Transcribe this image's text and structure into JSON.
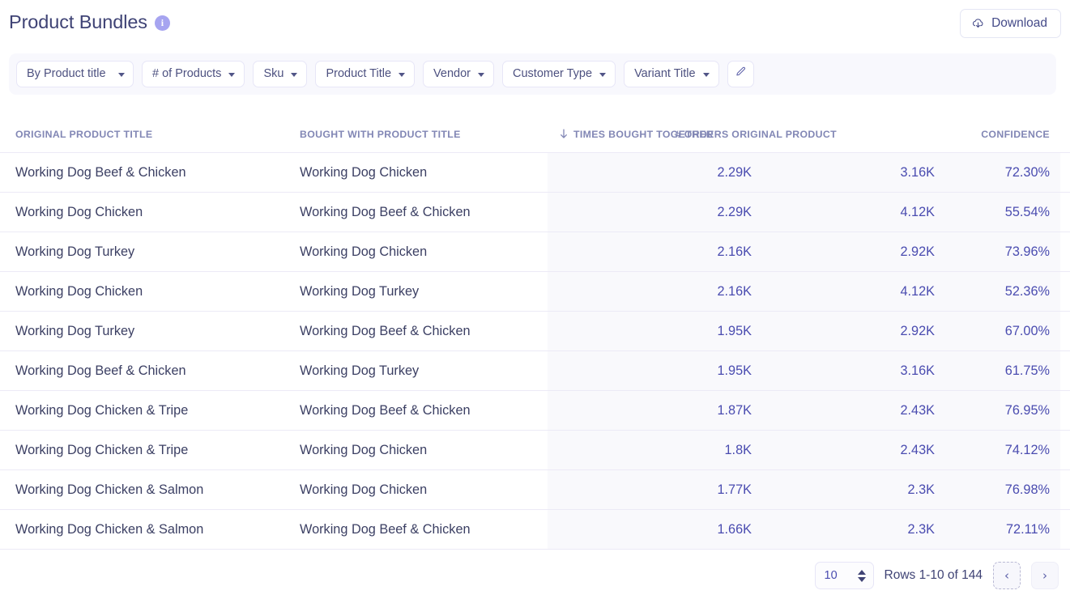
{
  "header": {
    "title": "Product Bundles",
    "info_icon": "info-icon",
    "info_glyph": "i",
    "download_label": "Download",
    "download_icon": "cloud-download-icon"
  },
  "filters": {
    "chips": [
      {
        "label": "By Product title",
        "icon": "chevron-down-icon"
      },
      {
        "label": "# of Products",
        "icon": "chevron-down-icon"
      },
      {
        "label": "Sku",
        "icon": "chevron-down-icon"
      },
      {
        "label": "Product Title",
        "icon": "chevron-down-icon"
      },
      {
        "label": "Vendor",
        "icon": "chevron-down-icon"
      },
      {
        "label": "Customer Type",
        "icon": "chevron-down-icon"
      },
      {
        "label": "Variant Title",
        "icon": "chevron-down-icon"
      }
    ],
    "edit_icon": "pencil-icon"
  },
  "table": {
    "columns": [
      {
        "key": "original",
        "label": "ORIGINAL PRODUCT TITLE",
        "align": "left"
      },
      {
        "key": "bought_with",
        "label": "BOUGHT WITH PRODUCT TITLE",
        "align": "left"
      },
      {
        "key": "times",
        "label": "TIMES BOUGHT TOGETHER",
        "align": "right",
        "sorted": "desc",
        "sort_icon": "arrow-down-icon"
      },
      {
        "key": "orders",
        "label": "# ORDERS ORIGINAL PRODUCT",
        "align": "right"
      },
      {
        "key": "confidence",
        "label": "CONFIDENCE",
        "align": "right"
      }
    ],
    "rows": [
      {
        "original": "Working Dog Beef & Chicken",
        "bought_with": "Working Dog Chicken",
        "times": "2.29K",
        "orders": "3.16K",
        "confidence": "72.30%"
      },
      {
        "original": "Working Dog Chicken",
        "bought_with": "Working Dog Beef & Chicken",
        "times": "2.29K",
        "orders": "4.12K",
        "confidence": "55.54%"
      },
      {
        "original": "Working Dog Turkey",
        "bought_with": "Working Dog Chicken",
        "times": "2.16K",
        "orders": "2.92K",
        "confidence": "73.96%"
      },
      {
        "original": "Working Dog Chicken",
        "bought_with": "Working Dog Turkey",
        "times": "2.16K",
        "orders": "4.12K",
        "confidence": "52.36%"
      },
      {
        "original": "Working Dog Turkey",
        "bought_with": "Working Dog Beef & Chicken",
        "times": "1.95K",
        "orders": "2.92K",
        "confidence": "67.00%"
      },
      {
        "original": "Working Dog Beef & Chicken",
        "bought_with": "Working Dog Turkey",
        "times": "1.95K",
        "orders": "3.16K",
        "confidence": "61.75%"
      },
      {
        "original": "Working Dog Chicken & Tripe",
        "bought_with": "Working Dog Beef & Chicken",
        "times": "1.87K",
        "orders": "2.43K",
        "confidence": "76.95%"
      },
      {
        "original": "Working Dog Chicken & Tripe",
        "bought_with": "Working Dog Chicken",
        "times": "1.8K",
        "orders": "2.43K",
        "confidence": "74.12%"
      },
      {
        "original": "Working Dog Chicken & Salmon",
        "bought_with": "Working Dog Chicken",
        "times": "1.77K",
        "orders": "2.3K",
        "confidence": "76.98%"
      },
      {
        "original": "Working Dog Chicken & Salmon",
        "bought_with": "Working Dog Beef & Chicken",
        "times": "1.66K",
        "orders": "2.3K",
        "confidence": "72.11%"
      }
    ]
  },
  "pagination": {
    "rows_per_page": "10",
    "rows_label": "Rows 1-10 of 144",
    "prev_icon": "chevron-left-icon",
    "next_icon": "chevron-right-icon",
    "prev_glyph": "‹",
    "next_glyph": "›"
  },
  "colors": {
    "accent": "#4a4cb0",
    "title": "#3f4375",
    "header_text": "#8287b5",
    "info_badge": "#a6a4f0",
    "filter_bar_bg": "#f8f8fd",
    "shaded_column_bg": "#f9f9fc",
    "row_border": "#eceaf6"
  }
}
